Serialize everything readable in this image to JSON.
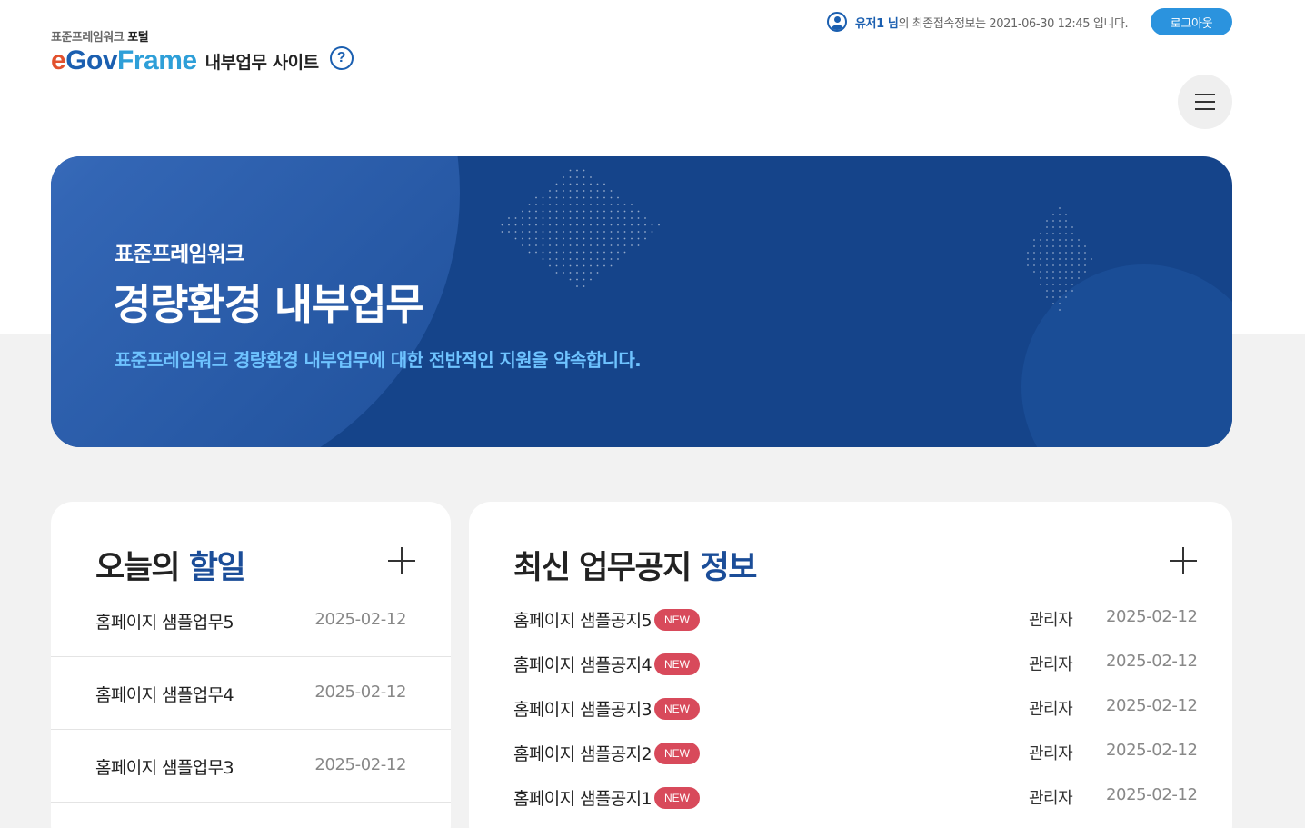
{
  "header": {
    "logo_top_gray": "표준프레임워크",
    "logo_top_bold": "포털",
    "logo_e": "e",
    "logo_gov": "Gov",
    "logo_frame": "Frame",
    "site_name": "내부업무 사이트",
    "help_symbol": "?"
  },
  "user": {
    "name": "유저1 님",
    "suffix": "의 최종접속정보는 2021-06-30 12:45 입니다.",
    "logout_label": "로그아웃"
  },
  "hero": {
    "sub": "표준프레임워크",
    "title": "경량환경 내부업무",
    "desc": "표준프레임워크 경량환경 내부업무에 대한 전반적인 지원을 약속합니다."
  },
  "todo": {
    "title_plain": "오늘의",
    "title_highlight": "할일",
    "items": [
      {
        "title": "홈페이지 샘플업무5",
        "date": "2025-02-12"
      },
      {
        "title": "홈페이지 샘플업무4",
        "date": "2025-02-12"
      },
      {
        "title": "홈페이지 샘플업무3",
        "date": "2025-02-12"
      }
    ]
  },
  "notice": {
    "title_plain": "최신 업무공지",
    "title_highlight": "정보",
    "items": [
      {
        "title": "홈페이지 샘플공지5",
        "badge": "NEW",
        "author": "관리자",
        "date": "2025-02-12"
      },
      {
        "title": "홈페이지 샘플공지4",
        "badge": "NEW",
        "author": "관리자",
        "date": "2025-02-12"
      },
      {
        "title": "홈페이지 샘플공지3",
        "badge": "NEW",
        "author": "관리자",
        "date": "2025-02-12"
      },
      {
        "title": "홈페이지 샘플공지2",
        "badge": "NEW",
        "author": "관리자",
        "date": "2025-02-12"
      },
      {
        "title": "홈페이지 샘플공지1",
        "badge": "NEW",
        "author": "관리자",
        "date": "2025-02-12"
      }
    ]
  },
  "colors": {
    "brand_blue": "#1b5fb0",
    "hero_bg": "#15448a",
    "hero_desc": "#6ec3ff",
    "logout_bg": "#2b93de",
    "badge_new": "#d84a5b"
  },
  "icons": {
    "user": "user-circle-icon",
    "help": "question-circle-icon",
    "menu": "hamburger-menu-icon",
    "more": "plus-icon"
  }
}
